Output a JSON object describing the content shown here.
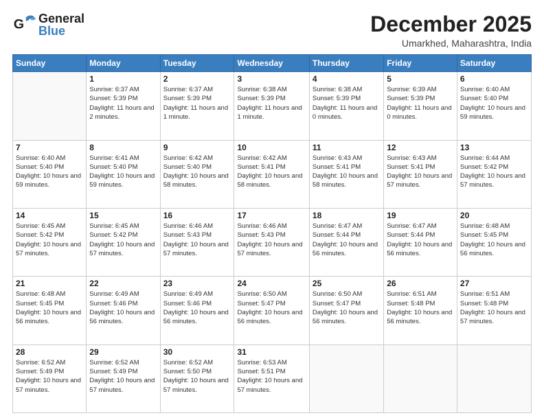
{
  "header": {
    "logo": {
      "general": "General",
      "blue": "Blue"
    },
    "title": "December 2025",
    "location": "Umarkhed, Maharashtra, India"
  },
  "days_of_week": [
    "Sunday",
    "Monday",
    "Tuesday",
    "Wednesday",
    "Thursday",
    "Friday",
    "Saturday"
  ],
  "weeks": [
    [
      {
        "day": "",
        "info": ""
      },
      {
        "day": "1",
        "info": "Sunrise: 6:37 AM\nSunset: 5:39 PM\nDaylight: 11 hours\nand 2 minutes."
      },
      {
        "day": "2",
        "info": "Sunrise: 6:37 AM\nSunset: 5:39 PM\nDaylight: 11 hours\nand 1 minute."
      },
      {
        "day": "3",
        "info": "Sunrise: 6:38 AM\nSunset: 5:39 PM\nDaylight: 11 hours\nand 1 minute."
      },
      {
        "day": "4",
        "info": "Sunrise: 6:38 AM\nSunset: 5:39 PM\nDaylight: 11 hours\nand 0 minutes."
      },
      {
        "day": "5",
        "info": "Sunrise: 6:39 AM\nSunset: 5:39 PM\nDaylight: 11 hours\nand 0 minutes."
      },
      {
        "day": "6",
        "info": "Sunrise: 6:40 AM\nSunset: 5:40 PM\nDaylight: 10 hours\nand 59 minutes."
      }
    ],
    [
      {
        "day": "7",
        "info": "Sunrise: 6:40 AM\nSunset: 5:40 PM\nDaylight: 10 hours\nand 59 minutes."
      },
      {
        "day": "8",
        "info": "Sunrise: 6:41 AM\nSunset: 5:40 PM\nDaylight: 10 hours\nand 59 minutes."
      },
      {
        "day": "9",
        "info": "Sunrise: 6:42 AM\nSunset: 5:40 PM\nDaylight: 10 hours\nand 58 minutes."
      },
      {
        "day": "10",
        "info": "Sunrise: 6:42 AM\nSunset: 5:41 PM\nDaylight: 10 hours\nand 58 minutes."
      },
      {
        "day": "11",
        "info": "Sunrise: 6:43 AM\nSunset: 5:41 PM\nDaylight: 10 hours\nand 58 minutes."
      },
      {
        "day": "12",
        "info": "Sunrise: 6:43 AM\nSunset: 5:41 PM\nDaylight: 10 hours\nand 57 minutes."
      },
      {
        "day": "13",
        "info": "Sunrise: 6:44 AM\nSunset: 5:42 PM\nDaylight: 10 hours\nand 57 minutes."
      }
    ],
    [
      {
        "day": "14",
        "info": "Sunrise: 6:45 AM\nSunset: 5:42 PM\nDaylight: 10 hours\nand 57 minutes."
      },
      {
        "day": "15",
        "info": "Sunrise: 6:45 AM\nSunset: 5:42 PM\nDaylight: 10 hours\nand 57 minutes."
      },
      {
        "day": "16",
        "info": "Sunrise: 6:46 AM\nSunset: 5:43 PM\nDaylight: 10 hours\nand 57 minutes."
      },
      {
        "day": "17",
        "info": "Sunrise: 6:46 AM\nSunset: 5:43 PM\nDaylight: 10 hours\nand 57 minutes."
      },
      {
        "day": "18",
        "info": "Sunrise: 6:47 AM\nSunset: 5:44 PM\nDaylight: 10 hours\nand 56 minutes."
      },
      {
        "day": "19",
        "info": "Sunrise: 6:47 AM\nSunset: 5:44 PM\nDaylight: 10 hours\nand 56 minutes."
      },
      {
        "day": "20",
        "info": "Sunrise: 6:48 AM\nSunset: 5:45 PM\nDaylight: 10 hours\nand 56 minutes."
      }
    ],
    [
      {
        "day": "21",
        "info": "Sunrise: 6:48 AM\nSunset: 5:45 PM\nDaylight: 10 hours\nand 56 minutes."
      },
      {
        "day": "22",
        "info": "Sunrise: 6:49 AM\nSunset: 5:46 PM\nDaylight: 10 hours\nand 56 minutes."
      },
      {
        "day": "23",
        "info": "Sunrise: 6:49 AM\nSunset: 5:46 PM\nDaylight: 10 hours\nand 56 minutes."
      },
      {
        "day": "24",
        "info": "Sunrise: 6:50 AM\nSunset: 5:47 PM\nDaylight: 10 hours\nand 56 minutes."
      },
      {
        "day": "25",
        "info": "Sunrise: 6:50 AM\nSunset: 5:47 PM\nDaylight: 10 hours\nand 56 minutes."
      },
      {
        "day": "26",
        "info": "Sunrise: 6:51 AM\nSunset: 5:48 PM\nDaylight: 10 hours\nand 56 minutes."
      },
      {
        "day": "27",
        "info": "Sunrise: 6:51 AM\nSunset: 5:48 PM\nDaylight: 10 hours\nand 57 minutes."
      }
    ],
    [
      {
        "day": "28",
        "info": "Sunrise: 6:52 AM\nSunset: 5:49 PM\nDaylight: 10 hours\nand 57 minutes."
      },
      {
        "day": "29",
        "info": "Sunrise: 6:52 AM\nSunset: 5:49 PM\nDaylight: 10 hours\nand 57 minutes."
      },
      {
        "day": "30",
        "info": "Sunrise: 6:52 AM\nSunset: 5:50 PM\nDaylight: 10 hours\nand 57 minutes."
      },
      {
        "day": "31",
        "info": "Sunrise: 6:53 AM\nSunset: 5:51 PM\nDaylight: 10 hours\nand 57 minutes."
      },
      {
        "day": "",
        "info": ""
      },
      {
        "day": "",
        "info": ""
      },
      {
        "day": "",
        "info": ""
      }
    ]
  ]
}
